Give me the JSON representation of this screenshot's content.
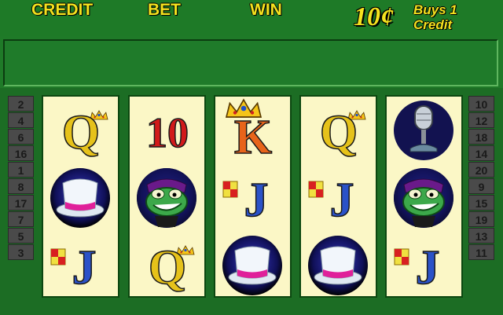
{
  "header": {
    "credit_label": "CREDIT",
    "bet_label": "BET",
    "win_label": "WIN",
    "denomination": "10¢",
    "buys_line1": "Buys 1",
    "buys_line2": "Credit"
  },
  "message_box": "",
  "paylines_left": [
    "2",
    "4",
    "6",
    "16",
    "1",
    "8",
    "17",
    "7",
    "5",
    "3"
  ],
  "paylines_right": [
    "10",
    "12",
    "18",
    "14",
    "20",
    "9",
    "15",
    "19",
    "13",
    "11"
  ],
  "reels": [
    [
      "Q",
      "top-hat",
      "J"
    ],
    [
      "10",
      "frog",
      "Q"
    ],
    [
      "K",
      "J",
      "top-hat"
    ],
    [
      "Q",
      "J",
      "top-hat"
    ],
    [
      "microphone",
      "frog",
      "J"
    ]
  ],
  "colors": {
    "background": "#1f7a28",
    "label_yellow": "#f4e21e",
    "reel_bg": "#fbf7c6",
    "j_blue": "#2a52c8",
    "ten_red": "#d21a1a",
    "k_orange": "#e8641a",
    "q_yellow": "#e6c21a"
  }
}
